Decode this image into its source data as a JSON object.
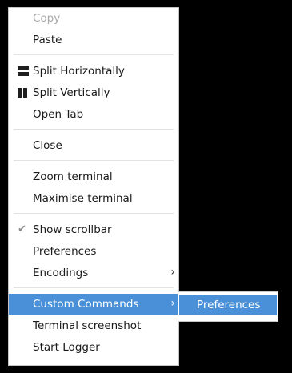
{
  "menu": {
    "copy": "Copy",
    "paste": "Paste",
    "split_horizontally": "Split Horizontally",
    "split_vertically": "Split Vertically",
    "open_tab": "Open Tab",
    "close": "Close",
    "zoom_terminal": "Zoom terminal",
    "maximise_terminal": "Maximise terminal",
    "show_scrollbar": "Show scrollbar",
    "preferences": "Preferences",
    "encodings": "Encodings",
    "custom_commands": "Custom Commands",
    "terminal_screenshot": "Terminal screenshot",
    "start_logger": "Start Logger"
  },
  "submenu": {
    "preferences": "Preferences"
  },
  "icons": {
    "check": "✔",
    "chevron": "›"
  },
  "colors": {
    "highlight": "#4a90d9",
    "disabled_text": "#a9a9a9"
  }
}
